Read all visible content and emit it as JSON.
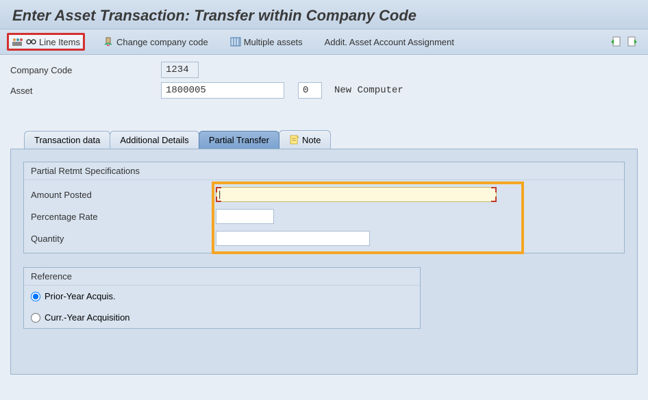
{
  "header": {
    "title": "Enter Asset Transaction: Transfer within Company Code"
  },
  "toolbar": {
    "line_items": "Line Items",
    "change_company": "Change company code",
    "multiple_assets": "Multiple assets",
    "addit_assignment": "Addit. Asset Account Assignment"
  },
  "form": {
    "company_code_label": "Company Code",
    "company_code_value": "1234",
    "asset_label": "Asset",
    "asset_value": "1800005",
    "asset_sub_value": "0",
    "asset_desc": "New Computer"
  },
  "tabs": {
    "t0": "Transaction data",
    "t1": "Additional Details",
    "t2": "Partial Transfer",
    "t3": "Note"
  },
  "partial": {
    "group_title": "Partial Retmt Specifications",
    "amount_label": "Amount Posted",
    "amount_value": "",
    "percentage_label": "Percentage Rate",
    "percentage_value": "",
    "quantity_label": "Quantity",
    "quantity_value": ""
  },
  "reference": {
    "title": "Reference",
    "prior_year": "Prior-Year Acquis.",
    "curr_year": "Curr.-Year Acquisition",
    "selected": "prior"
  }
}
